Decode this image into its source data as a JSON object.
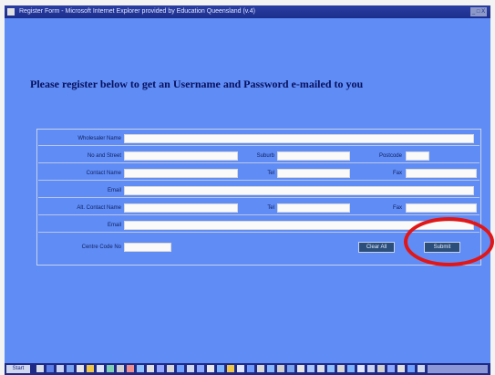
{
  "window": {
    "title": "Register Form - Microsoft Internet Explorer provided by Education Queensland (v.4)",
    "controls": "_ □ X"
  },
  "headline": "Please register below to get an Username and Password e-mailed to you",
  "form": {
    "wholesaler_name": "Wholesaler Name",
    "no_and_street": "No and Street",
    "suburb": "Suburb",
    "postcode": "Postcode",
    "contact_name": "Contact Name",
    "tel": "Tel",
    "fax": "Fax",
    "email": "Email",
    "alt_contact_name": "Alt. Contact Name",
    "alt_tel": "Tel",
    "alt_fax": "Fax",
    "alt_email": "Email",
    "centre_code": "Centre Code No",
    "clear_button": "Clear All",
    "submit_button": "Submit"
  },
  "taskbar": {
    "start_label": "Start"
  },
  "colors": {
    "page_background": "#5f8cf5",
    "title_text": "#08115e",
    "highlight_ring": "#e21616",
    "taskbar": "#1f2a86"
  },
  "icons": [
    "app-icon",
    "start-button",
    "task-icon",
    "tray-icon"
  ]
}
